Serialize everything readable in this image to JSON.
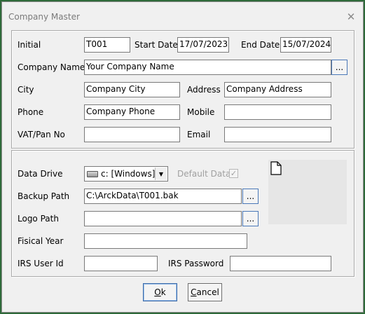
{
  "window": {
    "title": "Company Master",
    "close_glyph": "✕"
  },
  "company": {
    "initial_label": "Initial",
    "initial_value": "T001",
    "start_date_label": "Start Date",
    "start_date_value": "17/07/2023",
    "end_date_label": "End Date",
    "end_date_value": "15/07/2024",
    "name_label": "Company Name",
    "name_value": "Your Company Name",
    "name_browse_label": "...",
    "city_label": "City",
    "city_value": "Company City",
    "address_label": "Address",
    "address_value": "Company Address",
    "phone_label": "Phone",
    "phone_value": "Company Phone",
    "mobile_label": "Mobile",
    "mobile_value": "",
    "vat_label": "VAT/Pan No",
    "vat_value": "",
    "email_label": "Email",
    "email_value": ""
  },
  "data": {
    "drive_label": "Data Drive",
    "drive_value": "c: [Windows]",
    "default_data_label": "Default Data",
    "default_data_checked": true,
    "checkmark_glyph": "✓",
    "backup_label": "Backup Path",
    "backup_value": "C:\\ArckData\\T001.bak",
    "backup_browse_label": "...",
    "logo_label": "Logo Path",
    "logo_value": "",
    "logo_browse_label": "...",
    "fiscal_year_label": "Fisical Year",
    "fiscal_year_value": "",
    "irs_user_label": "IRS User Id",
    "irs_user_value": "",
    "irs_password_label": "IRS Password",
    "irs_password_value": ""
  },
  "buttons": {
    "ok_mnemonic": "O",
    "ok_rest": "k",
    "cancel_mnemonic": "C",
    "cancel_rest": "ancel"
  },
  "icons": {
    "close": "close-icon",
    "drive": "hard-drive-icon",
    "dropdown": "chevron-down-icon",
    "logo_placeholder": "document-icon"
  }
}
